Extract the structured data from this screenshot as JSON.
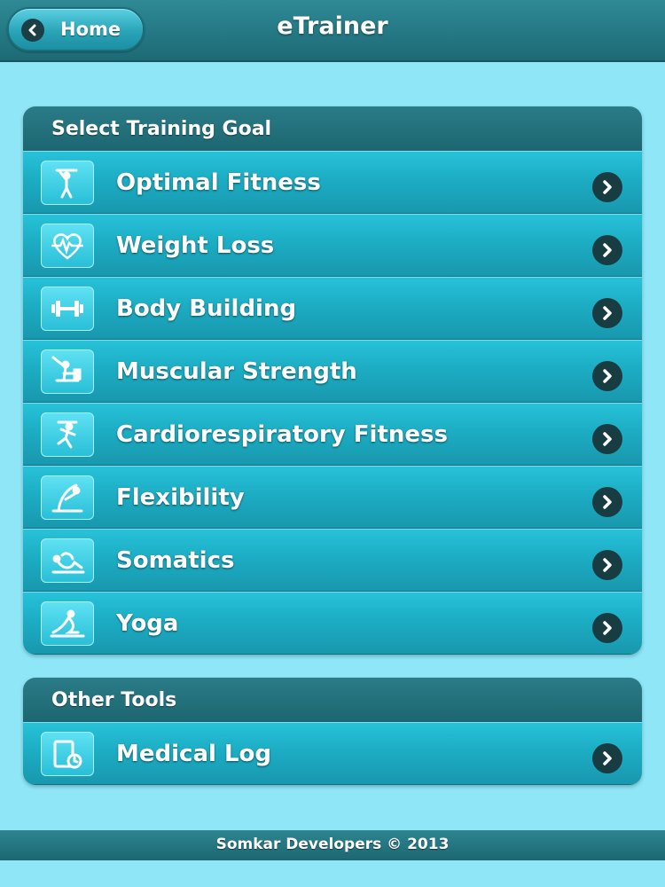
{
  "header": {
    "home_label": "Home",
    "title": "eTrainer"
  },
  "training_goals": {
    "header": "Select Training Goal",
    "items": [
      {
        "label": "Optimal Fitness",
        "icon": "stretching-figure-icon"
      },
      {
        "label": "Weight Loss",
        "icon": "heartbeat-scale-icon"
      },
      {
        "label": "Body Building",
        "icon": "dumbbell-icon"
      },
      {
        "label": "Muscular Strength",
        "icon": "weightlifter-icon"
      },
      {
        "label": "Cardiorespiratory Fitness",
        "icon": "running-figure-icon"
      },
      {
        "label": "Flexibility",
        "icon": "bending-figure-icon"
      },
      {
        "label": "Somatics",
        "icon": "floor-exercise-icon"
      },
      {
        "label": "Yoga",
        "icon": "yoga-pose-icon"
      }
    ]
  },
  "other_tools": {
    "header": "Other Tools",
    "items": [
      {
        "label": "Medical Log",
        "icon": "clipboard-clock-icon"
      }
    ]
  },
  "footer": {
    "text": "Somkar Developers © 2013"
  },
  "colors": {
    "background": "#8fe6f7",
    "header_bar": "#1d6a75",
    "list_item": "#1cadc4",
    "chevron_circle": "#173c42"
  }
}
